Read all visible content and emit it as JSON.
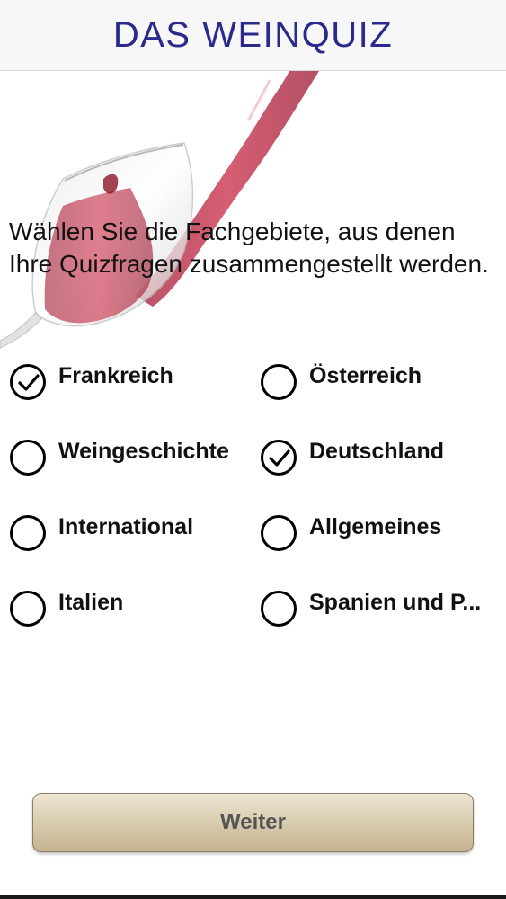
{
  "header": {
    "title": "DAS WEINQUIZ",
    "title_color": "#2a2a8c"
  },
  "intro": {
    "text": "Wählen Sie die Fachgebiete, aus denen Ihre Quizfragen zusammengestellt werden."
  },
  "options": [
    {
      "label": "Frankreich",
      "checked": true
    },
    {
      "label": "Österreich",
      "checked": false
    },
    {
      "label": "Weingeschichte",
      "checked": false
    },
    {
      "label": "Deutschland",
      "checked": true
    },
    {
      "label": "International",
      "checked": false
    },
    {
      "label": "Allgemeines",
      "checked": false
    },
    {
      "label": "Italien",
      "checked": false
    },
    {
      "label": "Spanien und P...",
      "checked": false
    }
  ],
  "footer": {
    "button_label": "Weiter"
  },
  "colors": {
    "wine": "#b5263c",
    "button_fill": "#d6c9ab"
  }
}
